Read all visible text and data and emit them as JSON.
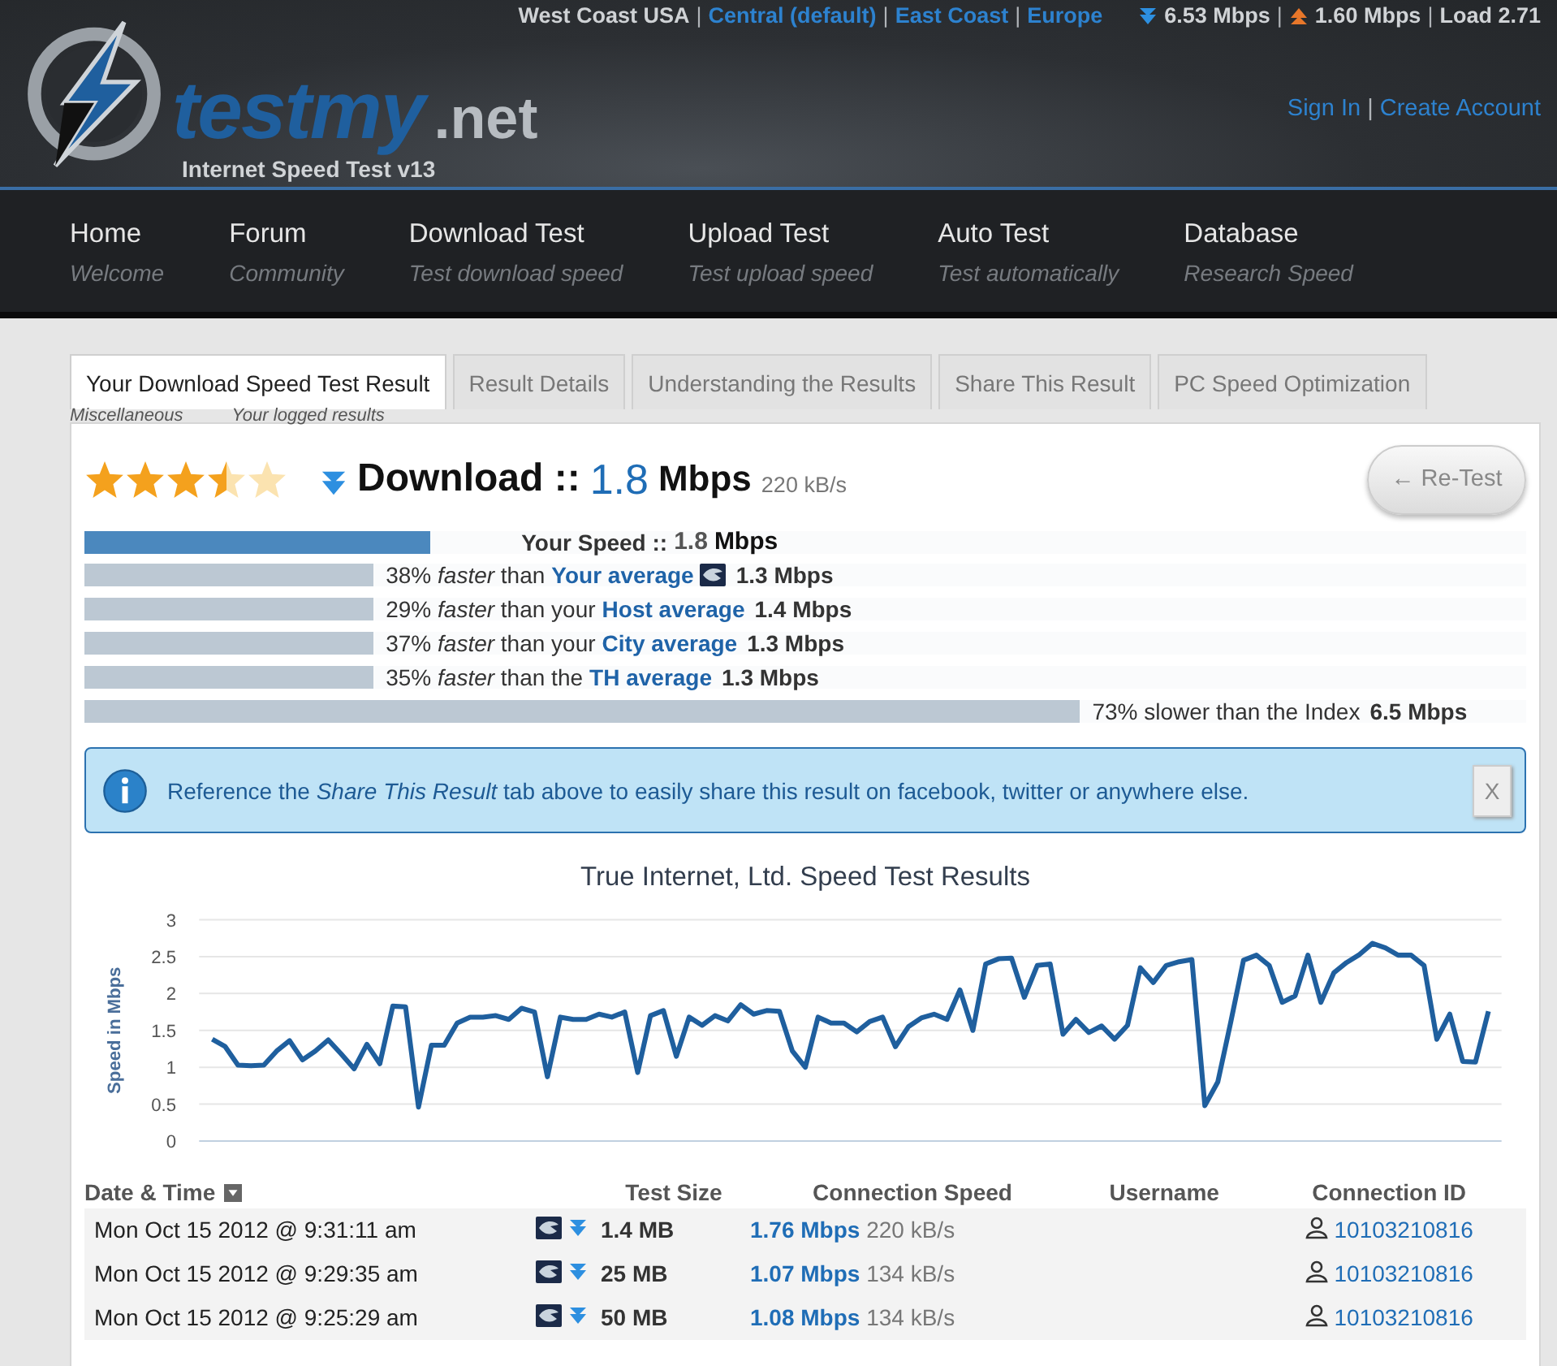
{
  "header": {
    "servers": [
      {
        "label": "West Coast USA",
        "selected": true
      },
      {
        "label": "Central (default)",
        "selected": false
      },
      {
        "label": "East Coast",
        "selected": false
      },
      {
        "label": "Europe",
        "selected": false
      }
    ],
    "load_stats": {
      "download": "6.53 Mbps",
      "upload": "1.60 Mbps",
      "load": "Load 2.71"
    },
    "logo": {
      "word": "testmy",
      "suffix": ".net",
      "tagline": "Internet Speed Test v13"
    },
    "account_links": [
      "Sign In",
      "Create Account"
    ],
    "separator": "|"
  },
  "nav": [
    {
      "label": "Home",
      "sub": "Welcome"
    },
    {
      "label": "Forum",
      "sub": "Community"
    },
    {
      "label": "Download Test",
      "sub": "Test download speed"
    },
    {
      "label": "Upload Test",
      "sub": "Test upload speed"
    },
    {
      "label": "Auto Test",
      "sub": "Test automatically"
    },
    {
      "label": "Database",
      "sub": "Research Speed"
    }
  ],
  "menu_peek": [
    "Miscellaneous",
    "Your logged results"
  ],
  "tabs": [
    {
      "label": "Your Download Speed Test Result",
      "selected": true
    },
    {
      "label": "Result Details",
      "selected": false
    },
    {
      "label": "Understanding the Results",
      "selected": false
    },
    {
      "label": "Share This Result",
      "selected": false
    },
    {
      "label": "PC Speed Optimization",
      "selected": false
    }
  ],
  "result": {
    "stars": 3.5,
    "title": "Download ::",
    "speed": "1.8",
    "unit": "Mbps",
    "rate": "220 kB/s",
    "retest_button": "← Re-Test"
  },
  "comparisons": [
    {
      "kind": "own",
      "label": "Your Speed ::",
      "value": "1.8",
      "unit": "Mbps",
      "level": 0.24
    },
    {
      "kind": "compare",
      "text": "38% *faster* than",
      "link": "Your average",
      "has_logo": true,
      "value": "1.3 Mbps",
      "level": 0.2
    },
    {
      "kind": "compare",
      "text": "29% *faster* than your",
      "link": "Host average",
      "has_logo": false,
      "value": "1.4 Mbps",
      "level": 0.2
    },
    {
      "kind": "compare",
      "text": "37% *faster* than your",
      "link": "City average",
      "has_logo": false,
      "value": "1.3 Mbps",
      "level": 0.2
    },
    {
      "kind": "compare",
      "text": "35% *faster* than the",
      "link": "TH average",
      "has_logo": false,
      "value": "1.3 Mbps",
      "level": 0.2
    },
    {
      "kind": "index",
      "text": "73% slower than the Index",
      "value": "6.5 Mbps",
      "level": 0.69
    }
  ],
  "alert": {
    "text": "Reference the *Share This Result* tab above to easily share this result on facebook, twitter or anywhere else.",
    "close": "X"
  },
  "chart": {
    "chart_data": {
      "type": "line",
      "title": "True Internet, Ltd. Speed Test Results",
      "ylabel": "Speed in Mbps",
      "ylim": [
        0,
        3
      ],
      "yticks": [
        0,
        0.5,
        1,
        1.5,
        2,
        2.5,
        3
      ],
      "grid": true,
      "series": [
        {
          "color": "#1f5f9e",
          "values": [
            1.38,
            1.28,
            1.03,
            1.02,
            1.03,
            1.22,
            1.36,
            1.1,
            1.22,
            1.37,
            1.18,
            0.98,
            1.31,
            1.05,
            1.83,
            1.82,
            0.46,
            1.3,
            1.3,
            1.6,
            1.68,
            1.68,
            1.7,
            1.65,
            1.8,
            1.75,
            0.87,
            1.68,
            1.65,
            1.65,
            1.72,
            1.68,
            1.75,
            0.93,
            1.7,
            1.77,
            1.15,
            1.68,
            1.57,
            1.7,
            1.63,
            1.85,
            1.72,
            1.77,
            1.76,
            1.22,
            1.0,
            1.68,
            1.6,
            1.6,
            1.48,
            1.62,
            1.68,
            1.28,
            1.55,
            1.67,
            1.72,
            1.65,
            2.05,
            1.5,
            2.4,
            2.47,
            2.48,
            1.95,
            2.38,
            2.4,
            1.45,
            1.65,
            1.47,
            1.56,
            1.38,
            1.57,
            2.35,
            2.15,
            2.38,
            2.43,
            2.46,
            0.48,
            0.8,
            1.6,
            2.45,
            2.52,
            2.38,
            1.88,
            1.97,
            2.52,
            1.88,
            2.28,
            2.42,
            2.53,
            2.68,
            2.62,
            2.52,
            2.52,
            2.38,
            1.38,
            1.72,
            1.08,
            1.07,
            1.76
          ]
        }
      ]
    }
  },
  "table": {
    "columns": [
      "Date & Time",
      "Test Size",
      "Connection Speed",
      "Username",
      "Connection ID"
    ],
    "rows": [
      {
        "date": "Mon Oct 15 2012 @ 9:31:11 am",
        "size": "1.4 MB",
        "speed": "1.76 Mbps",
        "rate": "220 kB/s",
        "connection_id": "10103210816"
      },
      {
        "date": "Mon Oct 15 2012 @ 9:29:35 am",
        "size": "25 MB",
        "speed": "1.07 Mbps",
        "rate": "134 kB/s",
        "connection_id": "10103210816"
      },
      {
        "date": "Mon Oct 15 2012 @ 9:25:29 am",
        "size": "50 MB",
        "speed": "1.08 Mbps",
        "rate": "134 kB/s",
        "connection_id": "10103210816"
      }
    ]
  }
}
